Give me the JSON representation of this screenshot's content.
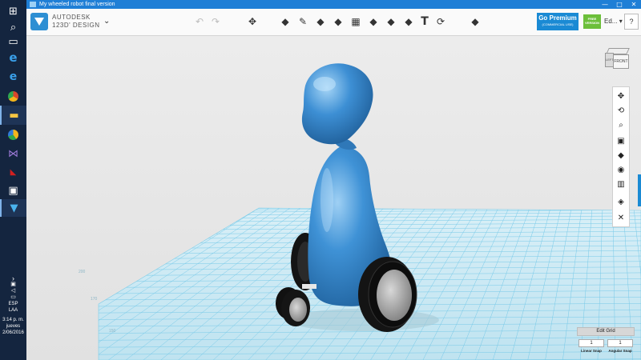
{
  "window": {
    "title": "My wheeled robot final version",
    "minimize_glyph": "—",
    "maximize_glyph": "□",
    "close_glyph": "✕"
  },
  "app": {
    "brand_line1": "AUTODESK",
    "brand_line2": "123D' DESIGN",
    "menu_glyph": "⌄"
  },
  "toolbar": {
    "undo_glyph": "↶",
    "redo_glyph": "↷",
    "tools": [
      {
        "name": "transform",
        "glyph": "✥"
      },
      {
        "name": "primitives",
        "glyph": "◆"
      },
      {
        "name": "sketch",
        "glyph": "✎"
      },
      {
        "name": "construct",
        "glyph": "◆"
      },
      {
        "name": "modify",
        "glyph": "◆"
      },
      {
        "name": "pattern",
        "glyph": "▦"
      },
      {
        "name": "group",
        "glyph": "◆"
      },
      {
        "name": "combine",
        "glyph": "◆"
      },
      {
        "name": "measure",
        "glyph": "◆"
      },
      {
        "name": "text",
        "glyph": "T"
      },
      {
        "name": "snap",
        "glyph": "⟳"
      },
      {
        "name": "material",
        "glyph": "◆"
      }
    ],
    "premium_title": "Go Premium",
    "premium_subtitle": "(COMMERCIAL USE)",
    "free_badge_line1": "FREE",
    "free_badge_line2": "VERSION",
    "user_label": "Ed...",
    "user_caret": "▾",
    "help_label": "?"
  },
  "taskbar": {
    "icons": [
      {
        "name": "start",
        "glyph": "⊞",
        "color": "#ffffff"
      },
      {
        "name": "search",
        "glyph": "⌕",
        "color": "#ffffff"
      },
      {
        "name": "task-view",
        "glyph": "▭",
        "color": "#ffffff"
      },
      {
        "name": "edge",
        "glyph": "e",
        "color": "#3aa0ea"
      },
      {
        "name": "ie",
        "glyph": "e",
        "color": "#f7c600"
      },
      {
        "name": "chrome",
        "glyph": "●",
        "color": "#d9482b"
      },
      {
        "name": "file-explorer",
        "glyph": "▬",
        "color": "#f6c543"
      },
      {
        "name": "chrome-alt",
        "glyph": "●",
        "color": "#f3b51c"
      },
      {
        "name": "visual-studio",
        "glyph": "⋈",
        "color": "#9d7ad8"
      },
      {
        "name": "app-red",
        "glyph": "◣",
        "color": "#d22020"
      },
      {
        "name": "photos",
        "glyph": "▣",
        "color": "#ffffff"
      },
      {
        "name": "123d-design",
        "glyph": "▼",
        "color": "#4ab3ee"
      }
    ],
    "tray_chevron": "›",
    "tray_network": "▣",
    "tray_volume": "◁",
    "tray_chat": "▭",
    "language": "ESP",
    "language_sub": "LAA",
    "time": "3:14 p. m.",
    "day": "jueves",
    "date": "2/06/2016"
  },
  "viewport": {
    "grid_labels": [
      "200",
      "170",
      "150"
    ]
  },
  "viewcube": {
    "front_label": "FRONT",
    "left_label": "LEFT"
  },
  "navigation": {
    "buttons": [
      {
        "name": "pan",
        "glyph": "✥"
      },
      {
        "name": "orbit",
        "glyph": "⟲"
      },
      {
        "name": "zoom",
        "glyph": "⌕"
      },
      {
        "name": "fit",
        "glyph": "▣"
      },
      {
        "name": "view",
        "glyph": "◆"
      },
      {
        "name": "visibility",
        "glyph": "◉"
      },
      {
        "name": "materials",
        "glyph": "▥"
      },
      {
        "name": "snap-view",
        "glyph": "◈"
      },
      {
        "name": "settings",
        "glyph": "✕"
      }
    ]
  },
  "grid_panel": {
    "edit_grid_label": "Edit Grid",
    "linear_snap_value": "1",
    "angular_snap_value": "1",
    "linear_snap_label": "Linear Snap",
    "angular_snap_label": "Angular Snap"
  },
  "colors": {
    "accent": "#1a8ad4",
    "model_blue": "#3a8ad0",
    "grid_line": "#6cc6e6"
  }
}
